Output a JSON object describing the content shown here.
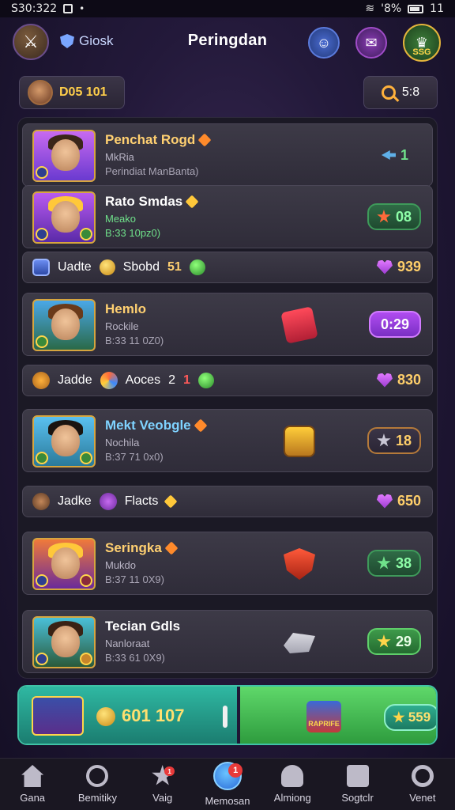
{
  "status_bar": {
    "time": "S30:322",
    "right": "'8%",
    "right_num": "11"
  },
  "header": {
    "clock_label": "Giosk",
    "title": "Peringdan",
    "profile_badge": "SSG"
  },
  "user_chip": {
    "label": "D05 101"
  },
  "search_chip": {
    "label": "5:8"
  },
  "rows": [
    {
      "title": "Penchat Rogd",
      "sub1": "MkRia",
      "sub2": "Perindiat ManBanta)",
      "value": "1"
    },
    {
      "title": "Rato Smdas",
      "sub1": "Meako",
      "sub2": "B:33 10pz0)",
      "value": "08"
    },
    {
      "label": "Uadte",
      "label2": "Sbobd",
      "label3": "51",
      "value": "939"
    },
    {
      "title": "Hemlo",
      "sub1": "Rockile",
      "sub2": "B:33 11 0Z0)",
      "value": "0:29"
    },
    {
      "label": "Jadde",
      "label2": "Aoces",
      "label3": "2",
      "label4": "1",
      "value": "830"
    },
    {
      "title": "Mekt Veobgle",
      "sub1": "Nochila",
      "sub2": "B:37 71 0x0)",
      "value": "18"
    },
    {
      "label": "Jadke",
      "label2": "Flacts",
      "value": "650"
    },
    {
      "title": "Seringka",
      "sub1": "Mukdo",
      "sub2": "B:37 11 0X9)",
      "value": "38"
    },
    {
      "title": "Tecian Gdls",
      "sub1": "Nanloraat",
      "sub2": "B:33 61 0X9)",
      "value": "29"
    }
  ],
  "action_bar": {
    "amount": "601 107",
    "mid_label": "RAPRIFE",
    "pill_value": "559"
  },
  "nav": [
    {
      "label": "Gana",
      "icon": "home-icon"
    },
    {
      "label": "Bemitiky",
      "icon": "gear-icon"
    },
    {
      "label": "Vaig",
      "icon": "star-icon",
      "badge": "1"
    },
    {
      "label": "Memosan",
      "icon": "globe-icon",
      "badge": "1"
    },
    {
      "label": "Almiong",
      "icon": "user-icon"
    },
    {
      "label": "Sogtclr",
      "icon": "box-icon"
    },
    {
      "label": "Venet",
      "icon": "search-icon"
    }
  ]
}
